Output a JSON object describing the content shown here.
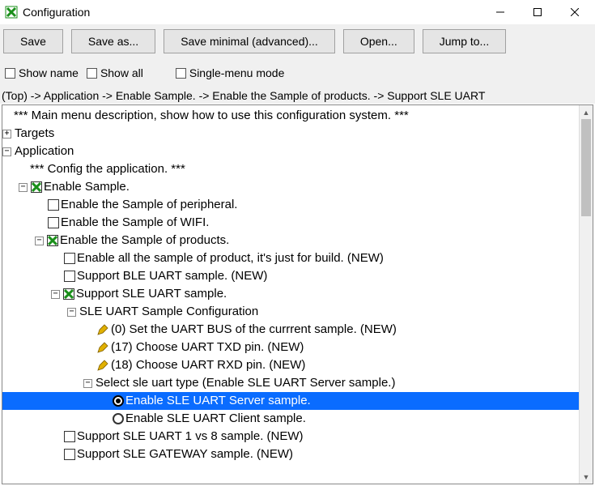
{
  "titlebar": {
    "title": "Configuration"
  },
  "toolbar": {
    "save": "Save",
    "save_as": "Save as...",
    "save_minimal": "Save minimal (advanced)...",
    "open": "Open...",
    "jump": "Jump to..."
  },
  "options": {
    "show_name": "Show name",
    "show_all": "Show all",
    "single_menu": "Single-menu mode"
  },
  "breadcrumb": "(Top) -> Application -> Enable Sample. -> Enable the Sample of products. -> Support SLE UART",
  "tree": {
    "main_desc": "*** Main menu description, show how to use this configuration system. ***",
    "targets": "Targets",
    "application": "Application",
    "app_desc": "*** Config the application. ***",
    "enable_sample": "Enable Sample.",
    "sample_peripheral": "Enable the Sample of peripheral.",
    "sample_wifi": "Enable the Sample of WIFI.",
    "sample_products": "Enable the Sample of products.",
    "enable_all": "Enable all the sample of product, it's just for build. (NEW)",
    "ble_uart": "Support BLE UART sample. (NEW)",
    "sle_uart": "Support SLE UART sample.",
    "sle_config": "SLE UART Sample Configuration",
    "uart_bus": "(0) Set the UART BUS of the currrent sample. (NEW)",
    "uart_txd": "(17) Choose UART TXD pin. (NEW)",
    "uart_rxd": "(18) Choose UART RXD pin. (NEW)",
    "sle_type": "Select sle uart type (Enable SLE UART Server sample.)",
    "sle_server": "Enable SLE UART Server sample.",
    "sle_client": "Enable SLE UART Client sample.",
    "sle_1v8": "Support SLE UART 1 vs 8 sample. (NEW)",
    "sle_gateway": "Support SLE GATEWAY sample. (NEW)"
  }
}
